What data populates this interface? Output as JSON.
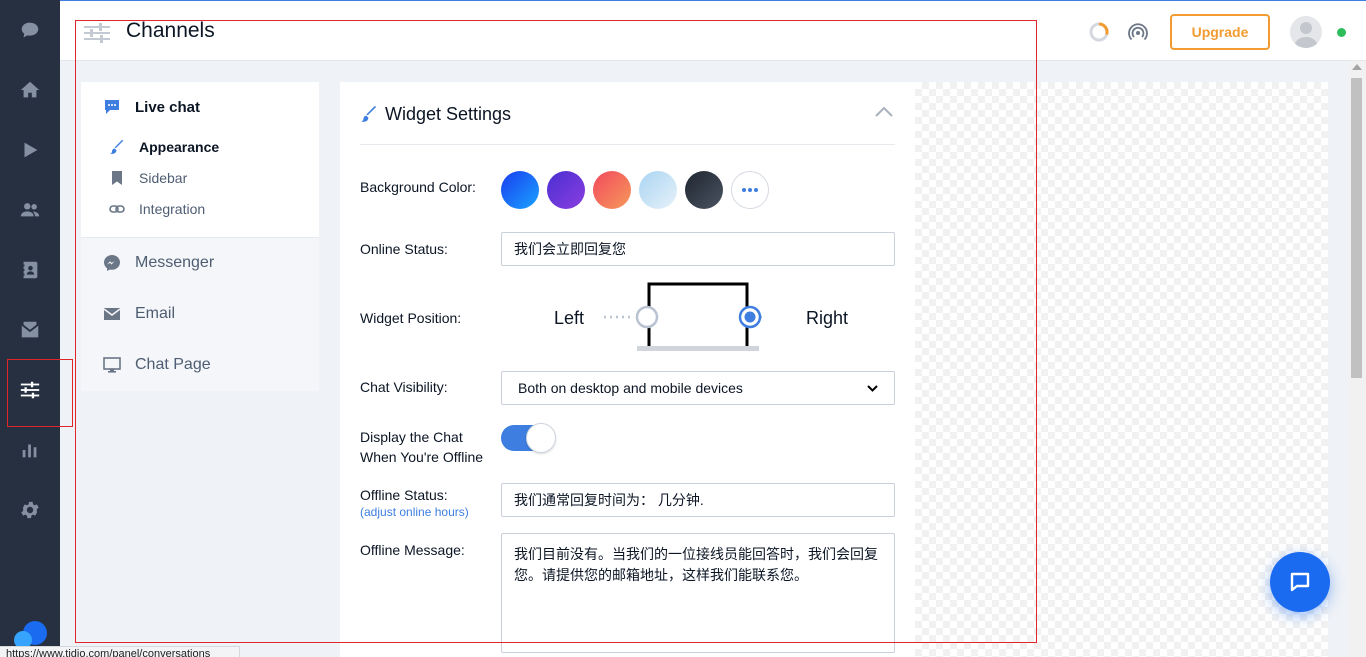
{
  "rail": {
    "items": [
      {
        "name": "chat-icon"
      },
      {
        "name": "home-icon"
      },
      {
        "name": "play-icon"
      },
      {
        "name": "visitors-icon"
      },
      {
        "name": "contacts-icon"
      },
      {
        "name": "mailbox-icon"
      },
      {
        "name": "channels-icon"
      },
      {
        "name": "analytics-icon"
      },
      {
        "name": "gear-icon"
      }
    ],
    "active": "channels-icon"
  },
  "header": {
    "title": "Channels",
    "upgrade_label": "Upgrade"
  },
  "subnav": {
    "livechat_label": "Live chat",
    "sub_items": [
      "Appearance",
      "Sidebar",
      "Integration"
    ],
    "channels": [
      "Messenger",
      "Email",
      "Chat Page"
    ]
  },
  "panel": {
    "title": "Widget Settings",
    "background_color_label": "Background Color:",
    "colors": [
      "#1a6bef",
      "#6a34d6",
      "#f2645c",
      "#b9dcf2",
      "#2c3440"
    ],
    "online_status_label": "Online Status:",
    "online_status_value": "我们会立即回复您",
    "widget_position_label": "Widget Position:",
    "position_left": "Left",
    "position_right": "Right",
    "chat_visibility_label": "Chat Visibility:",
    "chat_visibility_value": "Both on desktop and mobile devices",
    "display_offline_label_1": "Display the Chat",
    "display_offline_label_2": "When You're Offline",
    "offline_status_label": "Offline Status:",
    "adjust_hours_link": "adjust online hours",
    "offline_status_value": "我们通常回复时间为： 几分钟.",
    "offline_message_label": "Offline Message:",
    "offline_message_value": "我们目前没有。当我们的一位接线员能回答时，我们会回复您。请提供您的邮箱地址，这样我们能联系您。"
  },
  "status_url": "https://www.tidio.com/panel/conversations",
  "colors": {
    "accent": "#3d7ee0",
    "upgrade": "#f29b31",
    "rail": "#263041",
    "highlight": "#e0262a"
  }
}
